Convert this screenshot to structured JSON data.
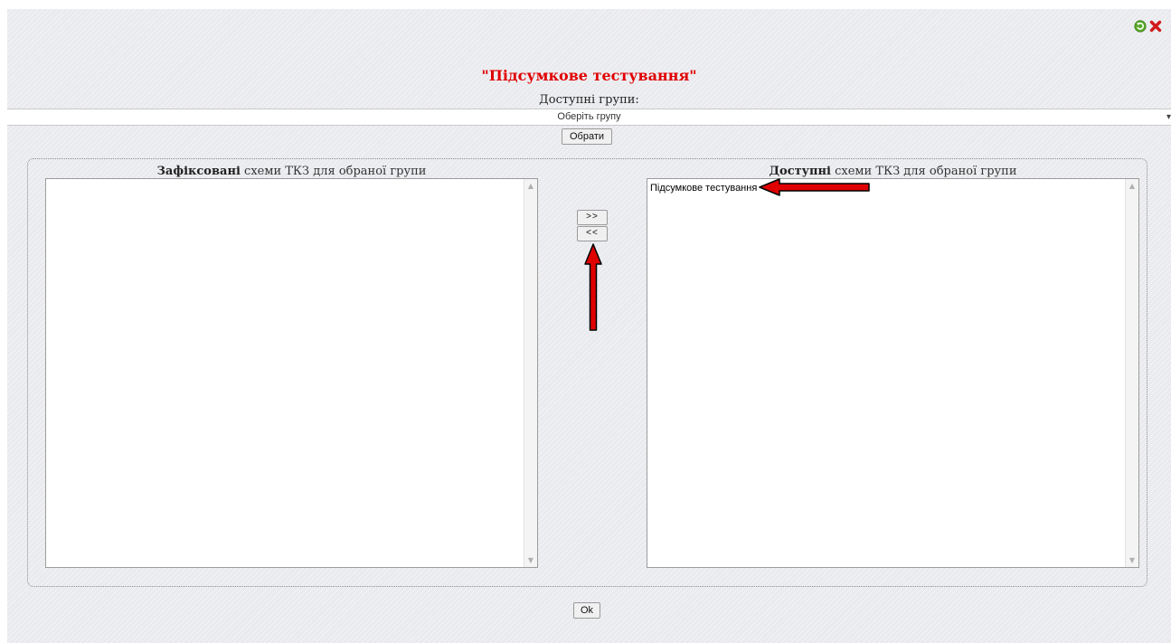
{
  "header": {
    "refresh_icon": "refresh-icon",
    "close_icon": "close-icon",
    "title": "\"Підсумкове тестування\"",
    "groups_label": "Доступні групи:"
  },
  "group_select": {
    "value": "Оберіть групу",
    "button": "Обрати"
  },
  "left_panel": {
    "title_bold": "Зафіксовані",
    "title_rest": " схеми ТКЗ для обраної групи",
    "items": []
  },
  "right_panel": {
    "title_bold": "Доступні",
    "title_rest": " схеми ТКЗ для обраної групи",
    "items": [
      "Підсумкове тестування"
    ]
  },
  "transfer": {
    "move_right": ">>",
    "move_left": "<<"
  },
  "footer": {
    "ok": "Ok"
  },
  "colors": {
    "title": "#e00000",
    "annotation_arrow": "#e00000"
  }
}
